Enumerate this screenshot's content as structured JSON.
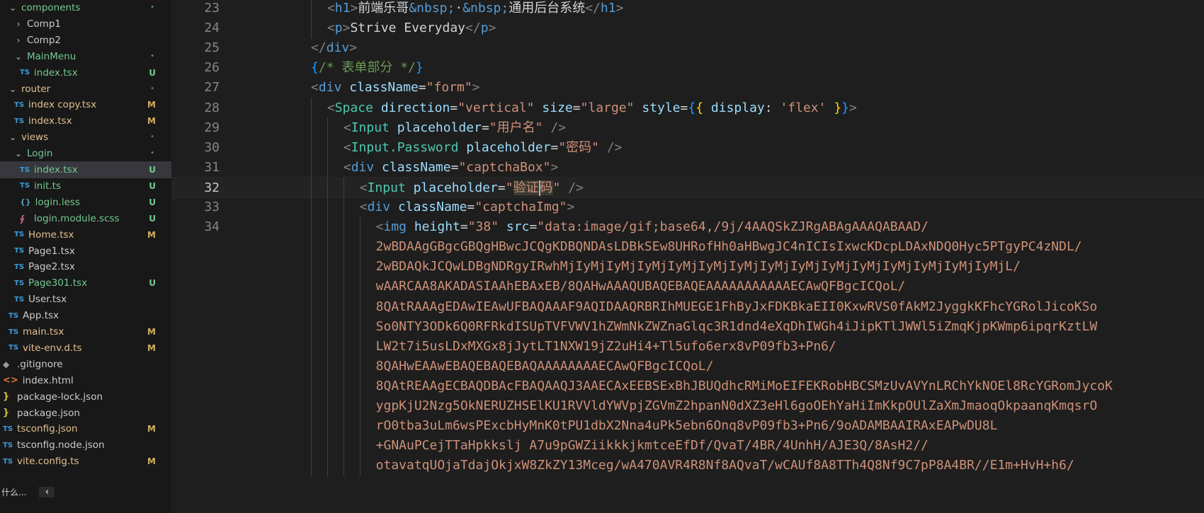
{
  "explorer": {
    "items": [
      {
        "label": "components",
        "kind": "folder-open",
        "indent": 1,
        "color": "green",
        "status": "•",
        "statusType": "dotg"
      },
      {
        "label": "Comp1",
        "kind": "folder-closed",
        "indent": 2,
        "color": "norm",
        "status": "",
        "statusType": ""
      },
      {
        "label": "Comp2",
        "kind": "folder-closed",
        "indent": 2,
        "color": "norm",
        "status": "",
        "statusType": ""
      },
      {
        "label": "MainMenu",
        "kind": "folder-open",
        "indent": 2,
        "color": "green",
        "status": "•",
        "statusType": "dotg"
      },
      {
        "label": "index.tsx",
        "kind": "ts",
        "indent": 3,
        "color": "green",
        "status": "U",
        "statusType": "U"
      },
      {
        "label": "router",
        "kind": "folder-open",
        "indent": 1,
        "color": "yellow",
        "status": "•",
        "statusType": "dot"
      },
      {
        "label": "index copy.tsx",
        "kind": "ts",
        "indent": 2,
        "color": "yellow",
        "status": "M",
        "statusType": "M"
      },
      {
        "label": "index.tsx",
        "kind": "ts",
        "indent": 2,
        "color": "yellow",
        "status": "M",
        "statusType": "M"
      },
      {
        "label": "views",
        "kind": "folder-open",
        "indent": 1,
        "color": "yellow",
        "status": "•",
        "statusType": "dot"
      },
      {
        "label": "Login",
        "kind": "folder-open",
        "indent": 2,
        "color": "green",
        "status": "•",
        "statusType": "dotg"
      },
      {
        "label": "index.tsx",
        "kind": "ts",
        "indent": 3,
        "color": "green",
        "status": "U",
        "statusType": "U",
        "selected": true
      },
      {
        "label": "init.ts",
        "kind": "ts",
        "indent": 3,
        "color": "green",
        "status": "U",
        "statusType": "U"
      },
      {
        "label": "login.less",
        "kind": "less",
        "indent": 3,
        "color": "green",
        "status": "U",
        "statusType": "U"
      },
      {
        "label": "login.module.scss",
        "kind": "scss",
        "indent": 3,
        "color": "green",
        "status": "U",
        "statusType": "U"
      },
      {
        "label": "Home.tsx",
        "kind": "ts",
        "indent": 2,
        "color": "yellow",
        "status": "M",
        "statusType": "M"
      },
      {
        "label": "Page1.tsx",
        "kind": "ts",
        "indent": 2,
        "color": "norm",
        "status": "",
        "statusType": ""
      },
      {
        "label": "Page2.tsx",
        "kind": "ts",
        "indent": 2,
        "color": "norm",
        "status": "",
        "statusType": ""
      },
      {
        "label": "Page301.tsx",
        "kind": "ts",
        "indent": 2,
        "color": "green",
        "status": "U",
        "statusType": "U"
      },
      {
        "label": "User.tsx",
        "kind": "ts",
        "indent": 2,
        "color": "norm",
        "status": "",
        "statusType": ""
      },
      {
        "label": "App.tsx",
        "kind": "ts",
        "indent": 1,
        "color": "norm",
        "status": "",
        "statusType": ""
      },
      {
        "label": "main.tsx",
        "kind": "ts",
        "indent": 1,
        "color": "yellow",
        "status": "M",
        "statusType": "M"
      },
      {
        "label": "vite-env.d.ts",
        "kind": "ts",
        "indent": 1,
        "color": "yellow",
        "status": "M",
        "statusType": "M"
      },
      {
        "label": ".gitignore",
        "kind": "git",
        "indent": 0,
        "color": "norm",
        "status": "",
        "statusType": ""
      },
      {
        "label": "index.html",
        "kind": "html",
        "indent": 0,
        "color": "norm",
        "status": "",
        "statusType": ""
      },
      {
        "label": "package-lock.json",
        "kind": "json",
        "indent": 0,
        "color": "norm",
        "status": "",
        "statusType": ""
      },
      {
        "label": "package.json",
        "kind": "json",
        "indent": 0,
        "color": "norm",
        "status": "",
        "statusType": ""
      },
      {
        "label": "tsconfig.json",
        "kind": "ts",
        "indent": 0,
        "color": "yellow",
        "status": "M",
        "statusType": "M"
      },
      {
        "label": "tsconfig.node.json",
        "kind": "ts",
        "indent": 0,
        "color": "norm",
        "status": "",
        "statusType": ""
      },
      {
        "label": "vite.config.ts",
        "kind": "ts",
        "indent": 0,
        "color": "yellow",
        "status": "M",
        "statusType": "M"
      }
    ],
    "overlay_text": "什么..."
  },
  "icons": {
    "ts": "TS",
    "json": "}",
    "html": "<>",
    "git": "◆",
    "less": "{}",
    "scss": "∮",
    "chevron_open": "⌄",
    "chevron_closed": "›",
    "collapse": "‹"
  },
  "editor": {
    "current_line": 32,
    "lines": [
      {
        "num": 23,
        "indent": 11,
        "tokens": [
          [
            "br",
            "<"
          ],
          [
            "tag",
            "h1"
          ],
          [
            "br",
            ">"
          ],
          [
            "txt",
            "前端乐哥"
          ],
          [
            "ent",
            "&nbsp;"
          ],
          [
            "txt",
            "·"
          ],
          [
            "ent",
            "&nbsp;"
          ],
          [
            "txt",
            "通用后台系统"
          ],
          [
            "br",
            "</"
          ],
          [
            "tag",
            "h1"
          ],
          [
            "br",
            ">"
          ]
        ]
      },
      {
        "num": 24,
        "indent": 11,
        "tokens": [
          [
            "br",
            "<"
          ],
          [
            "tag",
            "p"
          ],
          [
            "br",
            ">"
          ],
          [
            "txt",
            "Strive Everyday"
          ],
          [
            "br",
            "</"
          ],
          [
            "tag",
            "p"
          ],
          [
            "br",
            ">"
          ]
        ]
      },
      {
        "num": 25,
        "indent": 9,
        "tokens": [
          [
            "br",
            "</"
          ],
          [
            "tag",
            "div"
          ],
          [
            "br",
            ">"
          ]
        ]
      },
      {
        "num": 26,
        "indent": 9,
        "tokens": [
          [
            "b3",
            "{"
          ],
          [
            "cmt",
            "/* 表单部分 */"
          ],
          [
            "b3",
            "}"
          ]
        ]
      },
      {
        "num": 27,
        "indent": 9,
        "tokens": [
          [
            "br",
            "<"
          ],
          [
            "tag",
            "div"
          ],
          [
            "txt",
            " "
          ],
          [
            "attr",
            "className"
          ],
          [
            "txt",
            "="
          ],
          [
            "str",
            "\"form\""
          ],
          [
            "br",
            ">"
          ]
        ]
      },
      {
        "num": 28,
        "indent": 11,
        "tokens": [
          [
            "br",
            "<"
          ],
          [
            "comp",
            "Space"
          ],
          [
            "txt",
            " "
          ],
          [
            "attr",
            "direction"
          ],
          [
            "txt",
            "="
          ],
          [
            "str",
            "\"vertical\""
          ],
          [
            "txt",
            " "
          ],
          [
            "attr",
            "size"
          ],
          [
            "txt",
            "="
          ],
          [
            "str",
            "\"large\""
          ],
          [
            "txt",
            " "
          ],
          [
            "attr",
            "style"
          ],
          [
            "txt",
            "="
          ],
          [
            "b3",
            "{"
          ],
          [
            "b1",
            "{"
          ],
          [
            "txt",
            " "
          ],
          [
            "attr",
            "display"
          ],
          [
            "txt",
            ": "
          ],
          [
            "str",
            "'flex'"
          ],
          [
            "txt",
            " "
          ],
          [
            "b1",
            "}"
          ],
          [
            "b3",
            "}"
          ],
          [
            "br",
            ">"
          ]
        ]
      },
      {
        "num": 29,
        "indent": 13,
        "tokens": [
          [
            "br",
            "<"
          ],
          [
            "comp",
            "Input"
          ],
          [
            "txt",
            " "
          ],
          [
            "attr",
            "placeholder"
          ],
          [
            "txt",
            "="
          ],
          [
            "str",
            "\"用户名\""
          ],
          [
            "txt",
            " "
          ],
          [
            "br",
            "/>"
          ]
        ]
      },
      {
        "num": 30,
        "indent": 13,
        "tokens": [
          [
            "br",
            "<"
          ],
          [
            "comp",
            "Input.Password"
          ],
          [
            "txt",
            " "
          ],
          [
            "attr",
            "placeholder"
          ],
          [
            "txt",
            "="
          ],
          [
            "str",
            "\"密码\""
          ],
          [
            "txt",
            " "
          ],
          [
            "br",
            "/>"
          ]
        ]
      },
      {
        "num": 31,
        "indent": 13,
        "tokens": [
          [
            "br",
            "<"
          ],
          [
            "tag",
            "div"
          ],
          [
            "txt",
            " "
          ],
          [
            "attr",
            "className"
          ],
          [
            "txt",
            "="
          ],
          [
            "str",
            "\"captchaBox\""
          ],
          [
            "br",
            ">"
          ]
        ]
      },
      {
        "num": 32,
        "indent": 15,
        "tokens": [
          [
            "br",
            "<"
          ],
          [
            "comp",
            "Input"
          ],
          [
            "txt",
            " "
          ],
          [
            "attr",
            "placeholder"
          ],
          [
            "txt",
            "="
          ],
          [
            "str",
            "\""
          ],
          [
            "hl",
            "验证"
          ],
          [
            "cursor",
            ""
          ],
          [
            "hl",
            "码"
          ],
          [
            "str",
            "\""
          ],
          [
            "txt",
            " "
          ],
          [
            "br",
            "/>"
          ]
        ]
      },
      {
        "num": 33,
        "indent": 15,
        "tokens": [
          [
            "br",
            "<"
          ],
          [
            "tag",
            "div"
          ],
          [
            "txt",
            " "
          ],
          [
            "attr",
            "className"
          ],
          [
            "txt",
            "="
          ],
          [
            "str",
            "\"captchaImg\""
          ],
          [
            "br",
            ">"
          ]
        ]
      },
      {
        "num": 34,
        "indent": 17,
        "tokens": [
          [
            "br",
            "<"
          ],
          [
            "tag",
            "img"
          ],
          [
            "txt",
            " "
          ],
          [
            "attr",
            "height"
          ],
          [
            "txt",
            "="
          ],
          [
            "str",
            "\"38\""
          ],
          [
            "txt",
            " "
          ],
          [
            "attr",
            "src"
          ],
          [
            "txt",
            "="
          ],
          [
            "str",
            "\"data:image/gif;base64,/9j/4AAQSkZJRgABAgAAAQABAAD/"
          ]
        ]
      },
      {
        "num": null,
        "indent": 17,
        "tokens": [
          [
            "str",
            "2wBDAAgGBgcGBQgHBwcJCQgKDBQNDAsLDBkSEw8UHRofHh0aHBwgJC4nICIsIxwcKDcpLDAxNDQ0Hyc5PTgyPC4zNDL/"
          ]
        ]
      },
      {
        "num": null,
        "indent": 17,
        "tokens": [
          [
            "str",
            "2wBDAQkJCQwLDBgNDRgyIRwhMjIyMjIyMjIyMjIyMjIyMjIyMjIyMjIyMjIyMjIyMjIyMjIyMjIyMjIyMjL/"
          ]
        ]
      },
      {
        "num": null,
        "indent": 17,
        "tokens": [
          [
            "str",
            "wAARCAA8AKADASIAAhEBAxEB/8QAHwAAAQUBAQEBAQEAAAAAAAAAAAECAwQFBgcICQoL/"
          ]
        ]
      },
      {
        "num": null,
        "indent": 17,
        "tokens": [
          [
            "str",
            "8QAtRAAAgEDAwIEAwUFBAQAAAF9AQIDAAQRBRIhMUEGE1FhByJxFDKBkaEII0KxwRVS0fAkM2JyggkKFhcYGRolJicoKSo"
          ]
        ]
      },
      {
        "num": null,
        "indent": 17,
        "tokens": [
          [
            "str",
            "So0NTY3ODk6Q0RFRkdISUpTVFVWV1hZWmNkZWZnaGlqc3R1dnd4eXqDhIWGh4iJipKTlJWWl5iZmqKjpKWmp6ipqrKztLW"
          ]
        ]
      },
      {
        "num": null,
        "indent": 17,
        "tokens": [
          [
            "str",
            "LW2t7i5usLDxMXGx8jJytLT1NXW19jZ2uHi4+Tl5ufo6erx8vP09fb3+Pn6/"
          ]
        ]
      },
      {
        "num": null,
        "indent": 17,
        "tokens": [
          [
            "str",
            "8QAHwEAAwEBAQEBAQEBAQAAAAAAAAECAwQFBgcICQoL/"
          ]
        ]
      },
      {
        "num": null,
        "indent": 17,
        "tokens": [
          [
            "str",
            "8QAtREAAgECBAQDBAcFBAQAAQJ3AAECAxEEBSExBhJBUQdhcRMiMoEIFEKRobHBCSMzUvAVYnLRChYkNOEl8RcYGRomJycoK"
          ]
        ]
      },
      {
        "num": null,
        "indent": 17,
        "tokens": [
          [
            "str",
            "ygpKjU2Nzg5OkNERUZHSElKU1RVVldYWVpjZGVmZ2hpanN0dXZ3eHl6goOEhYaHiImKkpOUlZaXmJmaoqOkpaanqKmqsrO"
          ]
        ]
      },
      {
        "num": null,
        "indent": 17,
        "tokens": [
          [
            "str",
            "rO0tba3uLm6wsPExcbHyMnK0tPU1dbX2Nna4uPk5ebn6Onq8vP09fb3+Pn6/9oADAMBAAIRAxEAPwDU8L"
          ]
        ]
      },
      {
        "num": null,
        "indent": 17,
        "tokens": [
          [
            "str",
            "+GNAuPCejTTaHpkkslj A7u9pGWZiikkkjkmtceEfDf/QvaT/4BR/4UnhH/AJE3Q/8AsH2//"
          ]
        ]
      },
      {
        "num": null,
        "indent": 17,
        "tokens": [
          [
            "str",
            "otavatqUOjaTdajOkjxW8ZkZY13Mceg/wA470AVR4R8Nf8AQvaT/wCAUf8A8TTh4Q8Nf9C7pP8A4BR//E1m+HvH+h6/"
          ]
        ]
      }
    ]
  }
}
